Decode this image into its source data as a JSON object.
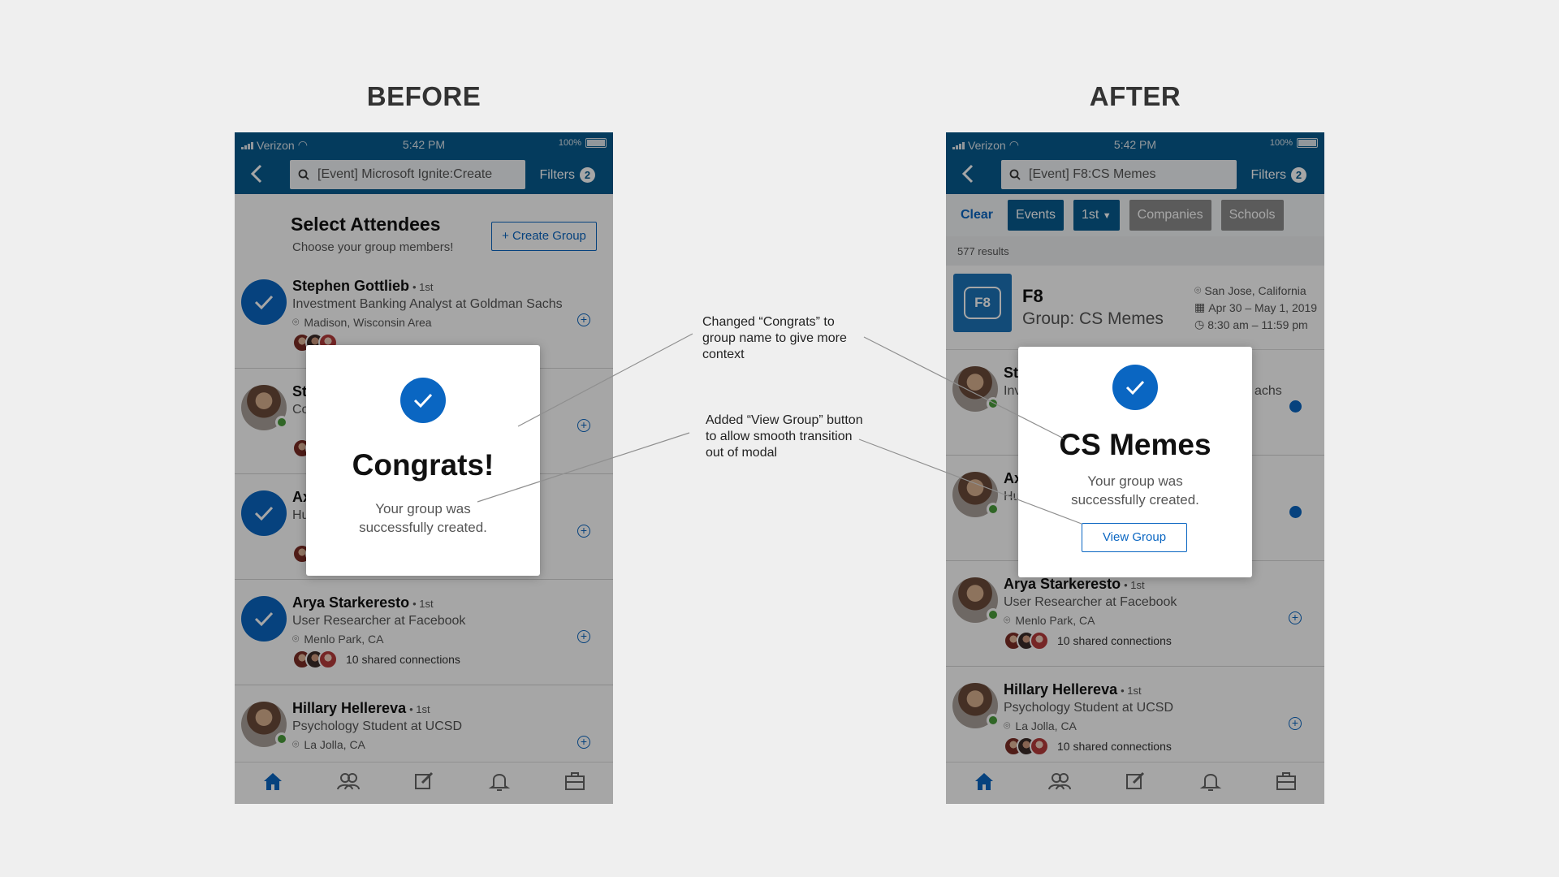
{
  "headings": {
    "before": "BEFORE",
    "after": "AFTER"
  },
  "status": {
    "carrier": "Verizon",
    "time": "5:42 PM",
    "battery": "100%"
  },
  "colors": {
    "brand": "#075b8f",
    "accent": "#0a66c2",
    "online": "#4a9d3b"
  },
  "before": {
    "search": "[Event] Microsoft Ignite:Create",
    "filters_label": "Filters",
    "filters_count": "2",
    "title": "Select Attendees",
    "subtitle": "Choose your group members!",
    "create_group": "+ Create Group",
    "people": [
      {
        "name": "Stephen Gottlieb",
        "degree": "• 1st",
        "role": "Investment Banking Analyst at Goldman Sachs",
        "location": "Madison, Wisconsin Area",
        "selected": true
      },
      {
        "name": "St",
        "role": "Co",
        "selected": false
      },
      {
        "name": "Ax",
        "role": "Hu",
        "selected": true
      },
      {
        "name": "Arya Starkeresto",
        "degree": "• 1st",
        "role": "User Researcher at Facebook",
        "location": "Menlo Park, CA",
        "connections": "10 shared connections",
        "selected": true
      },
      {
        "name": "Hillary Hellereva",
        "degree": "• 1st",
        "role": "Psychology Student at UCSD",
        "location": "La Jolla, CA",
        "selected": false
      }
    ],
    "modal": {
      "title": "Congrats!",
      "message": "Your group was successfully created."
    }
  },
  "after": {
    "search": "[Event] F8:CS Memes",
    "filters_label": "Filters",
    "filters_count": "2",
    "chips": {
      "clear": "Clear",
      "events": "Events",
      "first": "1st",
      "companies": "Companies",
      "schools": "Schools"
    },
    "results": "577 results",
    "event": {
      "logo": "F8",
      "name": "F8",
      "group": "Group: CS Memes",
      "location": "San Jose, California",
      "dates": "Apr 30 – May 1, 2019",
      "time": "8:30 am – 11:59 pm"
    },
    "people": [
      {
        "name": "St",
        "role": "Inv",
        "tail": "achs"
      },
      {
        "name": "Ax",
        "role": "Hu"
      },
      {
        "name": "Arya Starkeresto",
        "degree": "• 1st",
        "role": "User Researcher at Facebook",
        "location": "Menlo Park, CA",
        "connections": "10 shared connections"
      },
      {
        "name": "Hillary Hellereva",
        "degree": "• 1st",
        "role": "Psychology Student at UCSD",
        "location": "La Jolla, CA",
        "connections": "10 shared connections"
      }
    ],
    "modal": {
      "title": "CS Memes",
      "message": "Your group was successfully created.",
      "button": "View Group"
    }
  },
  "annotations": {
    "first": "Changed “Congrats” to group name to give more context",
    "second": "Added “View Group” button to allow smooth transition out of modal"
  }
}
